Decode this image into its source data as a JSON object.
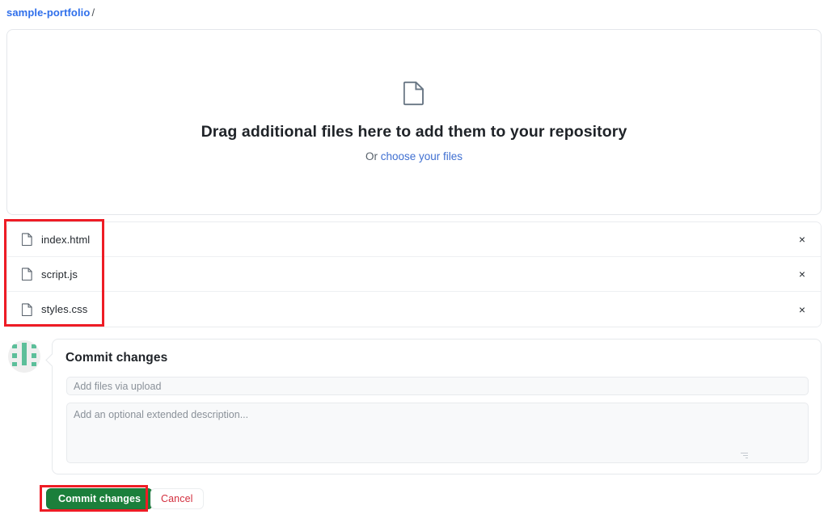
{
  "breadcrumb": {
    "repo": "sample-portfolio",
    "separator": "/"
  },
  "dropzone": {
    "icon": "file-icon",
    "title": "Drag additional files here to add them to your repository",
    "or_text": "Or ",
    "choose_link": "choose your files"
  },
  "files": {
    "remove_label": "×",
    "items": [
      {
        "name": "index.html",
        "icon": "file-icon"
      },
      {
        "name": "script.js",
        "icon": "file-icon"
      },
      {
        "name": "styles.css",
        "icon": "file-icon"
      }
    ]
  },
  "commit": {
    "avatar": "user-avatar-identicon",
    "title": "Commit changes",
    "message_placeholder": "Add files via upload",
    "message_value": "",
    "description_placeholder": "Add an optional extended description...",
    "description_value": "",
    "commit_button": "Commit changes",
    "cancel_button": "Cancel"
  },
  "colors": {
    "link": "#2f6feb",
    "commit_green": "#1b7f3b",
    "cancel_red": "#d3303f",
    "annotation_red": "#ee1c25",
    "avatar_green": "#5cbf9a"
  }
}
